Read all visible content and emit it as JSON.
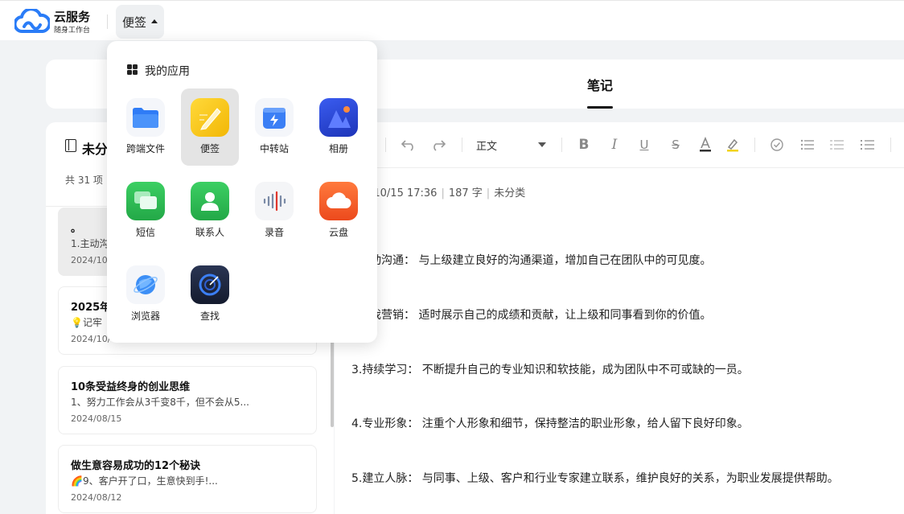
{
  "header": {
    "brand_title": "云服务",
    "brand_subtitle": "随身工作台",
    "app_switch_label": "便签"
  },
  "tabs": {
    "notes": "笔记"
  },
  "list": {
    "title": "未分",
    "count": "共 31 项",
    "notes": [
      {
        "title": "。",
        "preview": "1.主动沟",
        "date": "2024/10"
      },
      {
        "title": "2025年",
        "preview": "💡记牢",
        "date": "2024/10/"
      },
      {
        "title": "10条受益终身的创业思维",
        "preview": "1、努力工作会从3千变8千，但不会从5...",
        "date": "2024/08/15"
      },
      {
        "title": "做生意容易成功的12个秘诀",
        "preview": "🌈9、客户开了口，生意快到手!...",
        "date": "2024/08/12"
      }
    ]
  },
  "editor": {
    "paragraph_style": "正文",
    "meta": {
      "datetime": "/10/15 17:36",
      "words": "187 字",
      "category": "未分类"
    },
    "paragraphs": [
      "动沟通：  与上级建立良好的沟通渠道，增加自己在团队中的可见度。",
      "我营销：  适时展示自己的成绩和贡献，让上级和同事看到你的价值。",
      "3.持续学习：  不断提升自己的专业知识和软技能，成为团队中不可或缺的一员。",
      "4.专业形象：  注重个人形象和细节，保持整洁的职业形象，给人留下良好印象。",
      "5.建立人脉：  与同事、上级、客户和行业专家建立联系，维护良好的关系，为职业发展提供帮助。"
    ]
  },
  "dropdown": {
    "title": "我的应用",
    "apps": [
      {
        "label": "跨端文件",
        "icon": "folder-icon",
        "color": "#2f7cf6"
      },
      {
        "label": "便签",
        "icon": "notes-icon",
        "color": "#f7c318",
        "active": true
      },
      {
        "label": "中转站",
        "icon": "transfer-station-icon",
        "color": "#3b7ff5"
      },
      {
        "label": "相册",
        "icon": "gallery-icon",
        "color": "#2a4fdc"
      },
      {
        "label": "短信",
        "icon": "message-icon",
        "color": "#2fb955"
      },
      {
        "label": "联系人",
        "icon": "contacts-icon",
        "color": "#2fb955"
      },
      {
        "label": "录音",
        "icon": "recorder-icon",
        "color": "#e0362c"
      },
      {
        "label": "云盘",
        "icon": "cloud-drive-icon",
        "color": "#f05a24"
      },
      {
        "label": "浏览器",
        "icon": "browser-icon",
        "color": "#2f86f4"
      },
      {
        "label": "查找",
        "icon": "find-device-icon",
        "color": "#1f2a44"
      }
    ]
  }
}
